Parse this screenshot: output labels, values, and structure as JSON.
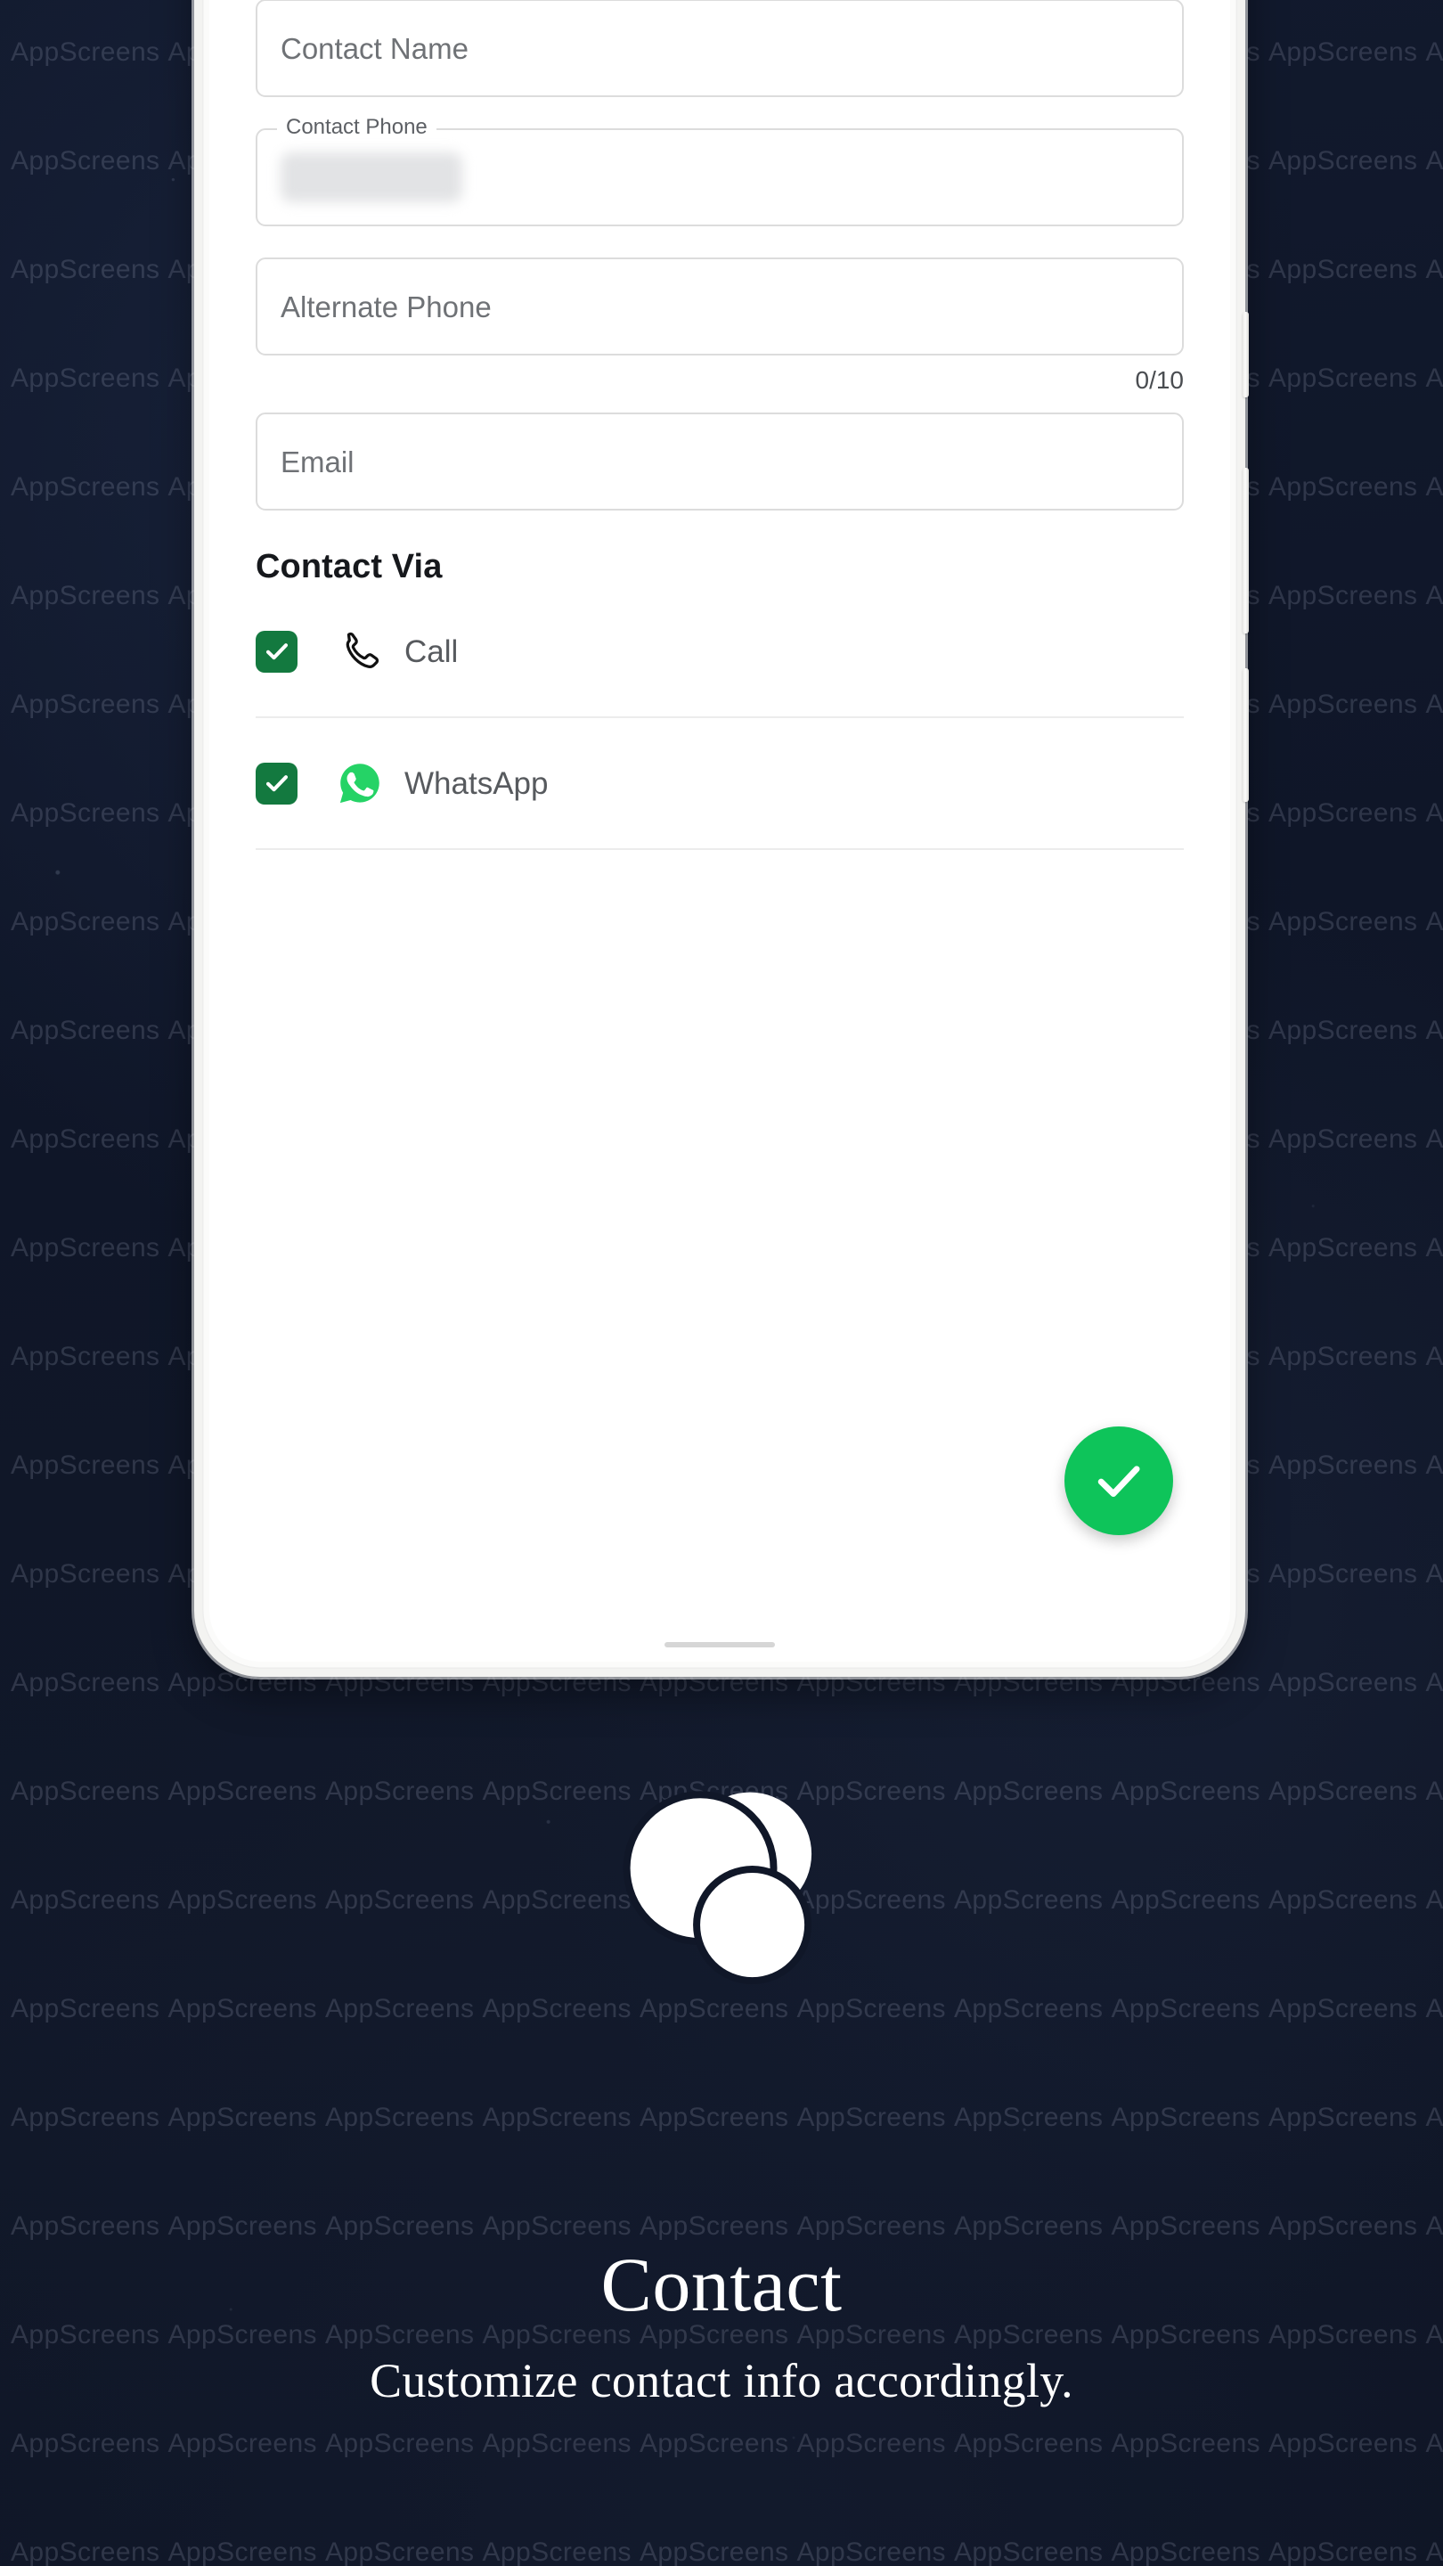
{
  "background": {
    "color": "#101728",
    "watermark_text": "AppScreens",
    "watermark_color": "#cdd7eb"
  },
  "phone": {
    "frame_color": "#f3f3f1",
    "screen_color": "#ffffff"
  },
  "form": {
    "fields": [
      {
        "name": "contact-name",
        "placeholder": "Contact Name",
        "value": "",
        "floating_label": "",
        "redacted": false
      },
      {
        "name": "contact-phone",
        "placeholder": "",
        "value": "",
        "floating_label": "Contact Phone",
        "redacted": true
      },
      {
        "name": "alternate-phone",
        "placeholder": "Alternate Phone",
        "value": "",
        "floating_label": "",
        "redacted": false
      },
      {
        "name": "email",
        "placeholder": "Email",
        "value": "",
        "floating_label": "",
        "redacted": false
      }
    ],
    "alternate_phone_counter": "0/10",
    "contact_via": {
      "heading": "Contact Via",
      "options": [
        {
          "label": "Call",
          "icon": "phone-call-icon",
          "checked": true
        },
        {
          "label": "WhatsApp",
          "icon": "whatsapp-icon",
          "checked": true
        }
      ]
    },
    "submit": {
      "icon": "check-icon",
      "color": "#0ec45a"
    },
    "checkbox_color": "#13793f"
  },
  "caption": {
    "title": "Contact",
    "subtitle": "Customize contact info accordingly."
  }
}
